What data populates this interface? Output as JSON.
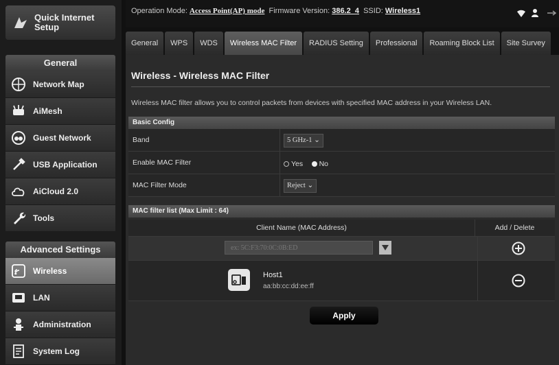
{
  "sidebar": {
    "quick_setup": "Quick Internet\nSetup",
    "general_header": "General",
    "general_items": [
      {
        "label": "Network Map",
        "icon": "globe-icon"
      },
      {
        "label": "AiMesh",
        "icon": "aimesh-icon"
      },
      {
        "label": "Guest Network",
        "icon": "guest-network-icon"
      },
      {
        "label": "USB Application",
        "icon": "usb-icon"
      },
      {
        "label": "AiCloud 2.0",
        "icon": "cloud-icon"
      },
      {
        "label": "Tools",
        "icon": "wrench-icon"
      }
    ],
    "advanced_header": "Advanced Settings",
    "advanced_items": [
      {
        "label": "Wireless",
        "icon": "wifi-icon",
        "active": true
      },
      {
        "label": "LAN",
        "icon": "lan-icon"
      },
      {
        "label": "Administration",
        "icon": "admin-icon"
      },
      {
        "label": "System Log",
        "icon": "log-icon"
      }
    ]
  },
  "topbar": {
    "op_mode_label": "Operation Mode:",
    "op_mode_value": "Access Point(AP) mode",
    "fw_label": "Firmware Version:",
    "fw_value": "386.2_4",
    "ssid_label": "SSID:",
    "ssid_value": "Wireless1"
  },
  "tabs": [
    "General",
    "WPS",
    "WDS",
    "Wireless MAC Filter",
    "RADIUS Setting",
    "Professional",
    "Roaming Block List",
    "Site Survey"
  ],
  "active_tab": "Wireless MAC Filter",
  "page": {
    "title": "Wireless - Wireless MAC Filter",
    "description": "Wireless MAC filter allows you to control packets from devices with specified MAC address in your Wireless LAN."
  },
  "basic_config": {
    "header": "Basic Config",
    "band_label": "Band",
    "band_value": "5 GHz-1",
    "enable_label": "Enable MAC Filter",
    "enable_yes": "Yes",
    "enable_no": "No",
    "enable_selected": "No",
    "mode_label": "MAC Filter Mode",
    "mode_value": "Reject"
  },
  "mac_list": {
    "header": "MAC filter list (Max Limit : 64)",
    "col_client": "Client Name (MAC Address)",
    "col_action": "Add / Delete",
    "input_placeholder": "ex: 5C:F3:70:0C:0B:ED",
    "entries": [
      {
        "name": "Host1",
        "mac": "aa:bb:cc:dd:ee:ff"
      }
    ]
  },
  "apply_label": "Apply",
  "colors": {
    "background": "#2b2b2b",
    "active_sidebar": "#7a7a7a",
    "header_bar": "#4f4f4f"
  }
}
